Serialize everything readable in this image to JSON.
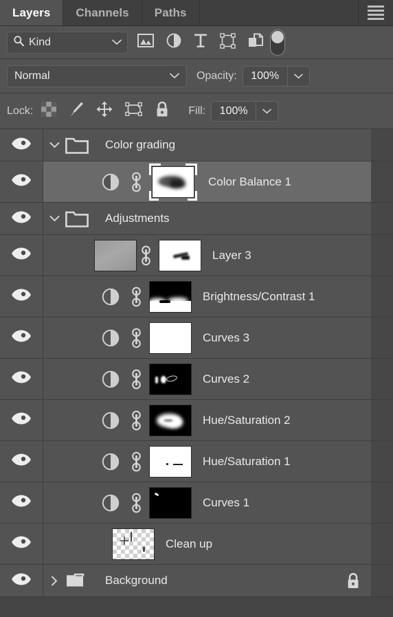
{
  "panel": {
    "title": "Layers",
    "menu_icon": "hamburger-menu-icon",
    "colors": {
      "panel_bg": "#454545",
      "row_bg": "#535353",
      "row_selected_bg": "#6a6a6a",
      "tab_inactive_bg": "#3f3f3f",
      "text": "#e9e9e9",
      "muted_text": "#b2b2b2",
      "divider": "#3e3e3e",
      "gutter": "#474747"
    }
  },
  "tabs": [
    {
      "label": "Layers",
      "active": true,
      "name": "tab-layers"
    },
    {
      "label": "Channels",
      "active": false,
      "name": "tab-channels"
    },
    {
      "label": "Paths",
      "active": false,
      "name": "tab-paths"
    }
  ],
  "filter_bar": {
    "kind_label": "Kind",
    "search_icon": "magnifier-icon",
    "chevron_icon": "chevron-down-icon",
    "filter_icons": [
      {
        "name": "filter-pixel-layers-icon",
        "title": "Pixel layers"
      },
      {
        "name": "filter-adjustment-layers-icon",
        "title": "Adjustment layers"
      },
      {
        "name": "filter-type-layers-icon",
        "title": "Type layers"
      },
      {
        "name": "filter-shape-layers-icon",
        "title": "Shape layers"
      },
      {
        "name": "filter-smart-objects-icon",
        "title": "Smart objects"
      }
    ],
    "toggle": {
      "name": "filter-enable-toggle",
      "state": "on"
    }
  },
  "blend_bar": {
    "blend_mode": "Normal",
    "opacity_label": "Opacity:",
    "opacity_value": "100%",
    "chevron_icon": "chevron-down-icon"
  },
  "lock_bar": {
    "lock_label": "Lock:",
    "fill_label": "Fill:",
    "fill_value": "100%",
    "lock_icons": [
      {
        "name": "lock-transparent-pixels-icon"
      },
      {
        "name": "lock-image-pixels-icon"
      },
      {
        "name": "lock-position-icon"
      },
      {
        "name": "lock-artboard-nesting-icon"
      },
      {
        "name": "lock-all-icon"
      }
    ]
  },
  "layers": [
    {
      "name": "Color grading",
      "type": "group",
      "visible": true,
      "expanded": true,
      "selected": false,
      "indent": 0,
      "locked": false
    },
    {
      "name": "Color Balance 1",
      "type": "adjustment",
      "visible": true,
      "selected": true,
      "indent": 1,
      "linked": true,
      "thumb": "adjustment-icon",
      "mask": "white-with-dark-blob",
      "mask_active": true,
      "locked": false
    },
    {
      "name": "Adjustments",
      "type": "group",
      "visible": true,
      "expanded": true,
      "selected": false,
      "indent": 0,
      "locked": false
    },
    {
      "name": "Layer 3",
      "type": "pixel",
      "visible": true,
      "selected": false,
      "indent": 1,
      "linked": true,
      "thumb": "gray-pixel",
      "mask": "white-with-small-dark-streak",
      "mask_active": false,
      "locked": false
    },
    {
      "name": "Brightness/Contrast 1",
      "type": "adjustment",
      "visible": true,
      "selected": false,
      "indent": 1,
      "linked": true,
      "thumb": "adjustment-icon",
      "mask": "black-with-white-bottom",
      "mask_active": false,
      "locked": false
    },
    {
      "name": "Curves 3",
      "type": "adjustment",
      "visible": true,
      "selected": false,
      "indent": 1,
      "linked": true,
      "thumb": "adjustment-icon",
      "mask": "all-white",
      "mask_active": false,
      "locked": false
    },
    {
      "name": "Curves 2",
      "type": "adjustment",
      "visible": true,
      "selected": false,
      "indent": 1,
      "linked": true,
      "thumb": "adjustment-icon",
      "mask": "black-with-small-white-marks",
      "mask_active": false,
      "locked": false
    },
    {
      "name": "Hue/Saturation 2",
      "type": "adjustment",
      "visible": true,
      "selected": false,
      "indent": 1,
      "linked": true,
      "thumb": "adjustment-icon",
      "mask": "black-with-white-blob",
      "mask_active": false,
      "locked": false
    },
    {
      "name": "Hue/Saturation 1",
      "type": "adjustment",
      "visible": true,
      "selected": false,
      "indent": 1,
      "linked": true,
      "thumb": "adjustment-icon",
      "mask": "white-with-small-dark-marks",
      "mask_active": false,
      "locked": false
    },
    {
      "name": "Curves 1",
      "type": "adjustment",
      "visible": true,
      "selected": false,
      "indent": 1,
      "linked": true,
      "thumb": "adjustment-icon",
      "mask": "black-with-tiny-white-mark",
      "mask_active": false,
      "locked": false
    },
    {
      "name": "Clean up",
      "type": "pixel",
      "visible": true,
      "selected": false,
      "indent": 1,
      "linked": false,
      "thumb": "transparent-checker",
      "mask": null,
      "mask_active": false,
      "locked": false
    },
    {
      "name": "Background",
      "type": "group",
      "visible": true,
      "expanded": false,
      "selected": false,
      "indent": 0,
      "locked": true,
      "lock_icon": "lock-closed-icon"
    }
  ]
}
